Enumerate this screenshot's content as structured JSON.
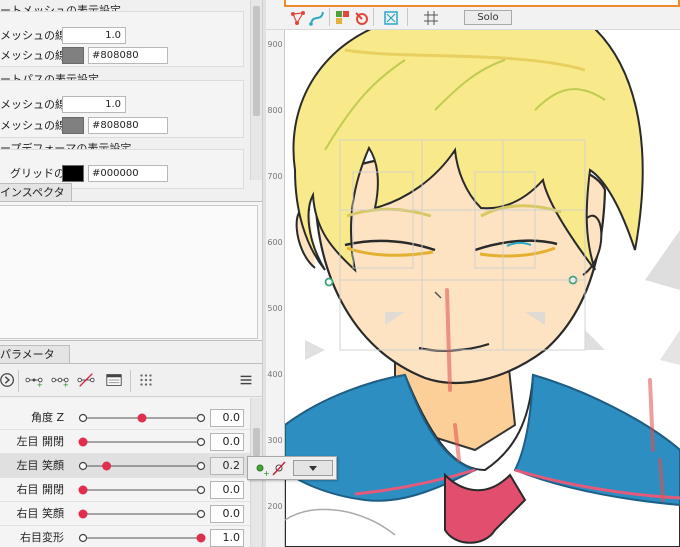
{
  "display_settings": {
    "group1_title": "ートメッシュの表示設定",
    "group1_width_label": "メッシュの線幅",
    "group1_width_value": "1.0",
    "group1_color_label": "メッシュの線色",
    "group1_color_hex": "#808080",
    "group2_title": "ートパスの表示設定",
    "group2_width_label": "メッシュの線幅",
    "group2_width_value": "1.0",
    "group2_color_label": "メッシュの線色",
    "group2_color_hex": "#808080",
    "group3_title": "ープデフォーマの表示設定",
    "group3_grid_label": "グリッドの色",
    "group3_grid_hex": "#000000"
  },
  "inspector": {
    "tab_label": "インスペクタ"
  },
  "parameters": {
    "tab_label": "パラメータ",
    "rows": [
      {
        "label": "角度 Z",
        "value": "0.0",
        "knob": 0.5,
        "keys": [
          0,
          0.5,
          1
        ],
        "selected": false
      },
      {
        "label": "左目 開閉",
        "value": "0.0",
        "knob": 0.0,
        "keys": [
          0,
          1
        ],
        "selected": false
      },
      {
        "label": "左目 笑顔",
        "value": "0.2",
        "knob": 0.2,
        "keys": [
          0,
          1
        ],
        "selected": true
      },
      {
        "label": "右目 開閉",
        "value": "0.0",
        "knob": 0.0,
        "keys": [
          0,
          1
        ],
        "selected": false
      },
      {
        "label": "右目 笑顔",
        "value": "0.0",
        "knob": 0.0,
        "keys": [
          1
        ],
        "selected": false
      },
      {
        "label": "右目変形",
        "value": "1.0",
        "knob": 1.0,
        "keys": [
          0
        ],
        "selected": false
      }
    ]
  },
  "canvas": {
    "solo_label": "Solo",
    "ruler_ticks": [
      "900",
      "800",
      "700",
      "600",
      "500",
      "400",
      "300",
      "200"
    ],
    "accent_color": "#f08a2a"
  }
}
